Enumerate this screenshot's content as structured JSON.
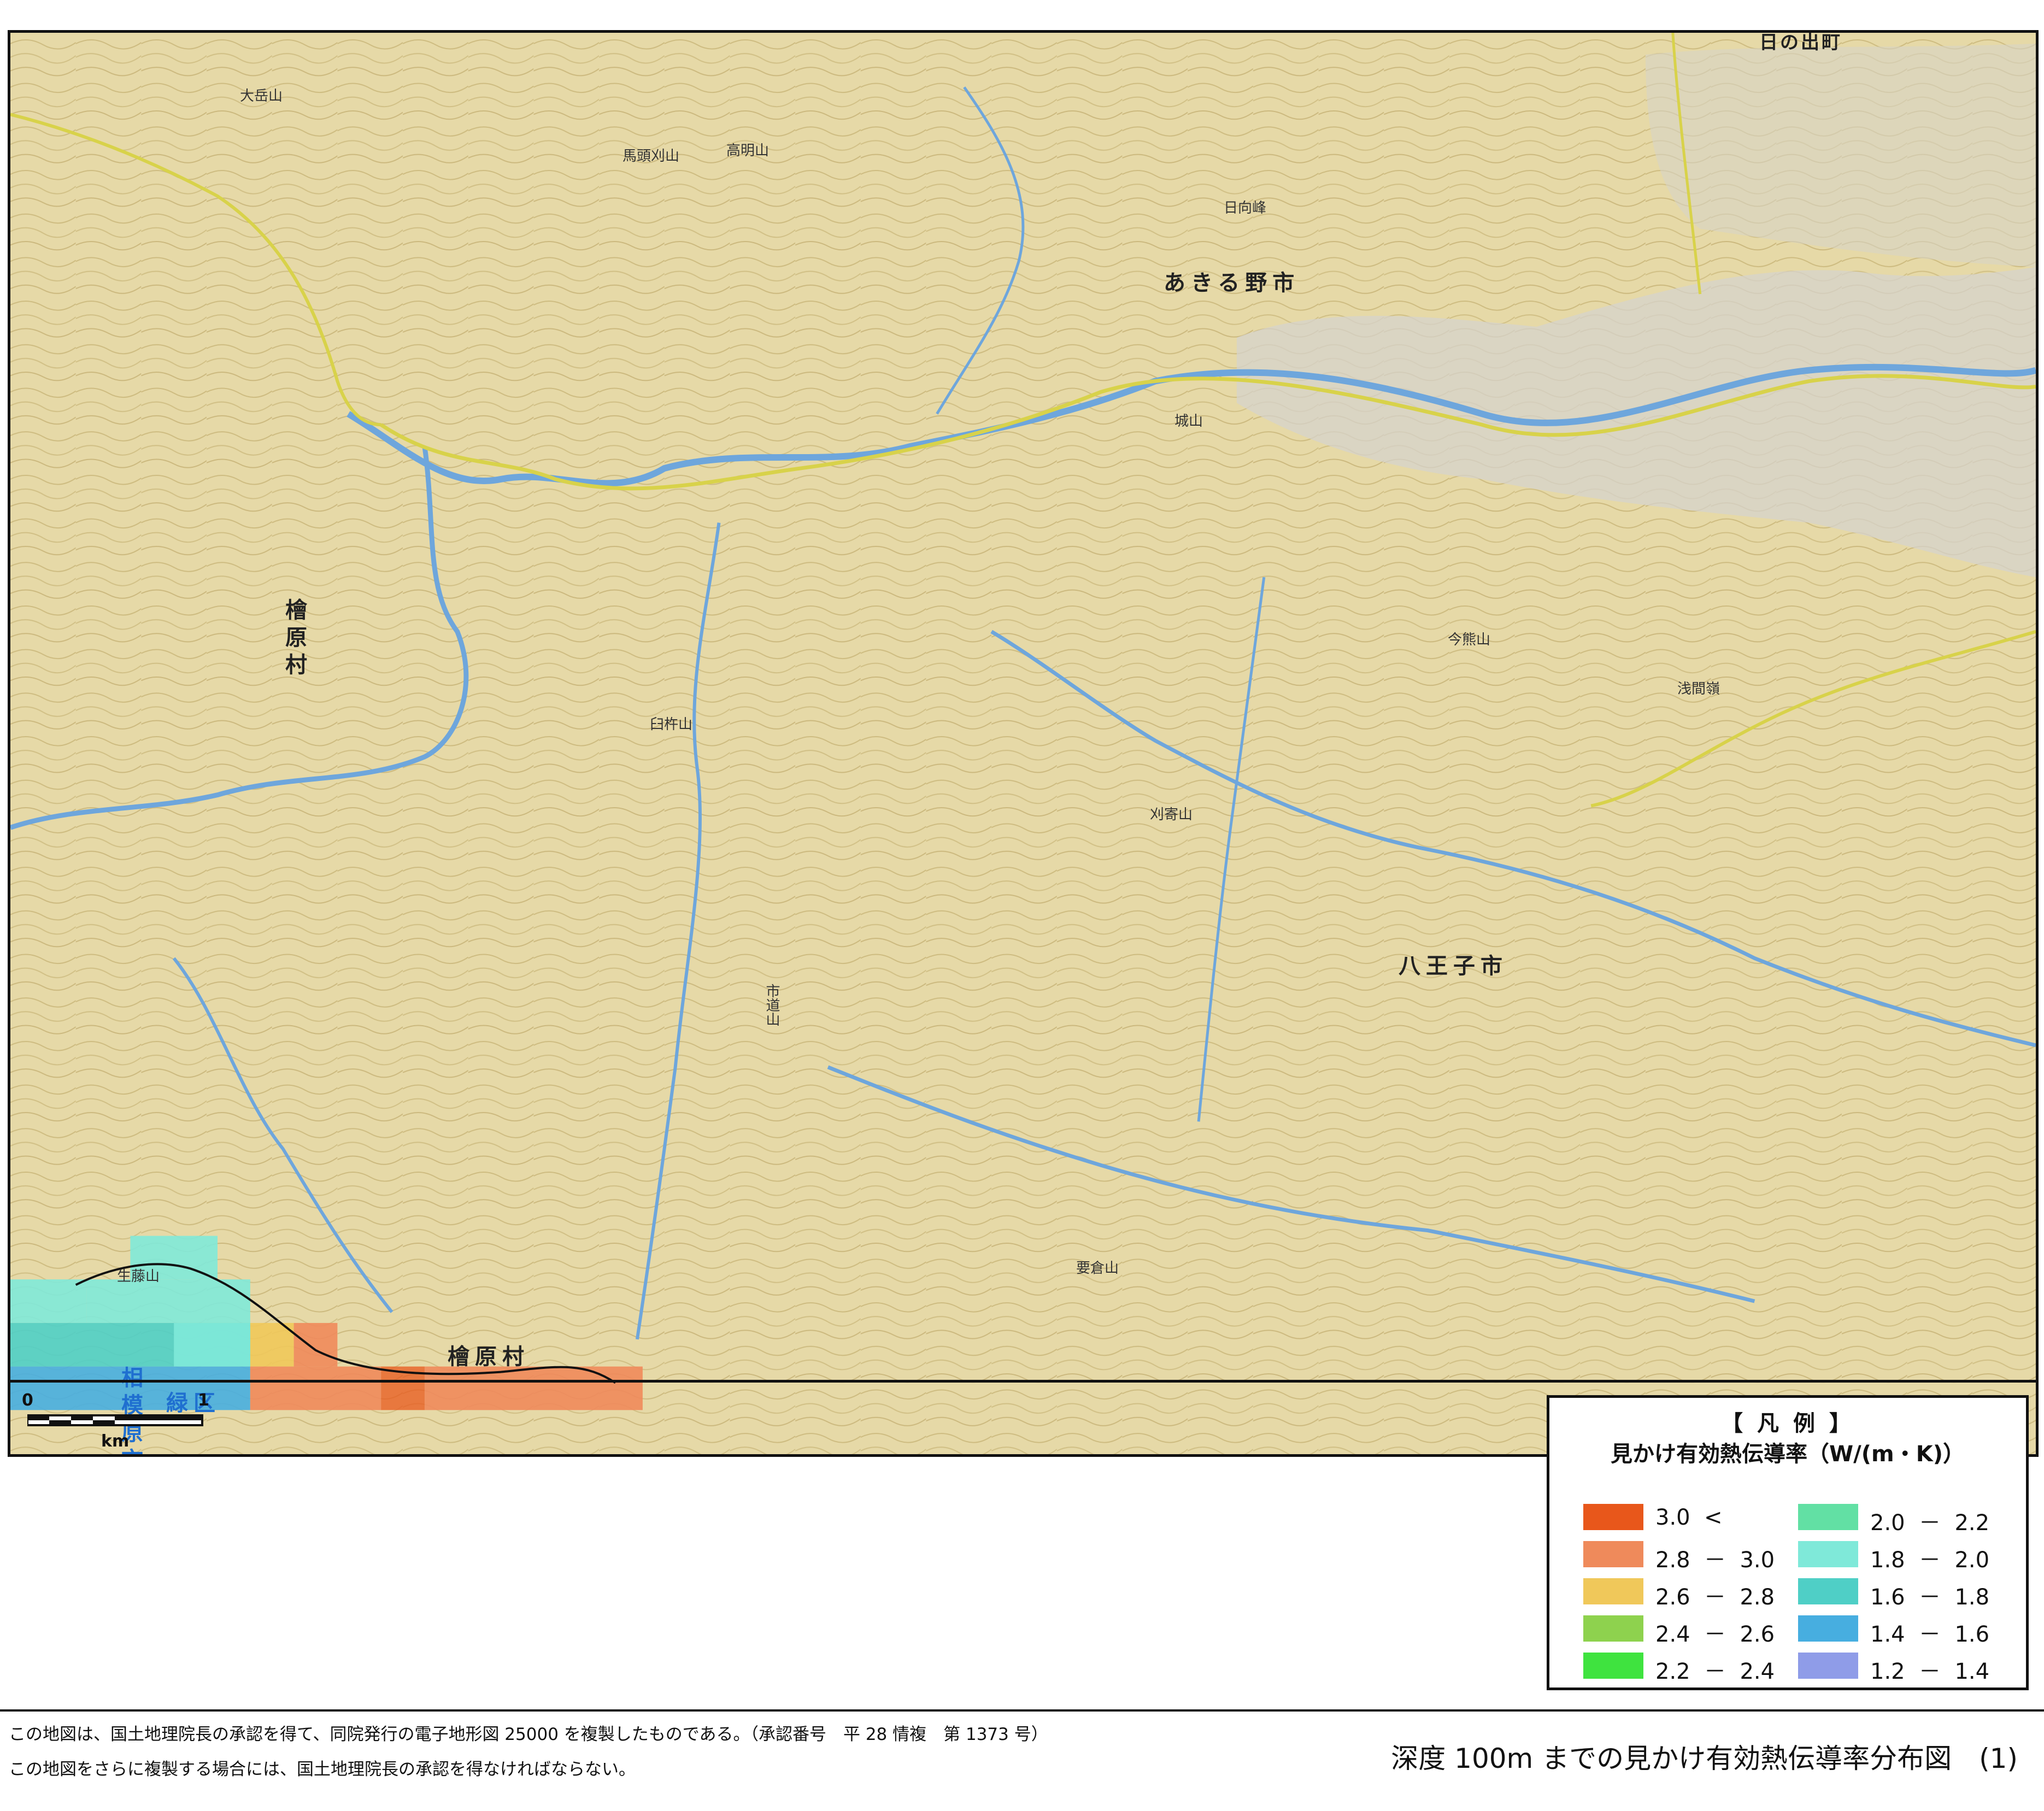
{
  "map": {
    "labels": {
      "hinode": "日の出町",
      "akiruno": "あきる野市",
      "hinohara_north": "檜原村",
      "hinohara_south": "檜原村",
      "hachioji": "八王子市",
      "sagamihara_ward": "緑区",
      "sagamihara_city": "相模原市"
    },
    "peaks": [
      "馬頭刈山",
      "高明山",
      "大岳山",
      "日向峰",
      "臼杵山",
      "刈寄山",
      "市道山",
      "要倉山",
      "城山",
      "生藤山",
      "浅間嶺",
      "今熊山"
    ],
    "scale": {
      "start": "0",
      "end": "1",
      "unit": "km"
    }
  },
  "legend": {
    "title": "【 凡 例 】",
    "subtitle": "見かけ有効熱伝導率（W/(m・K)）",
    "items": [
      {
        "label": "3.0  <",
        "color": "#e8571b"
      },
      {
        "label": "2.8  －  3.0",
        "color": "#ef8a5b"
      },
      {
        "label": "2.6  －  2.8",
        "color": "#f0c85a"
      },
      {
        "label": "2.4  －  2.6",
        "color": "#8ed24e"
      },
      {
        "label": "2.2  －  2.4",
        "color": "#3fe33f"
      },
      {
        "label": "2.0  －  2.2",
        "color": "#62e0a4"
      },
      {
        "label": "1.8  －  2.0",
        "color": "#7fe9d9"
      },
      {
        "label": "1.6  －  1.8",
        "color": "#4fcfc6"
      },
      {
        "label": "1.4  －  1.6",
        "color": "#47aee0"
      },
      {
        "label": "1.2  －  1.4",
        "color": "#8f9ce8"
      }
    ]
  },
  "footer": {
    "credit1": "この地図は、国土地理院長の承認を得て、同院発行の電子地形図 25000 を複製したものである。（承認番号　平 28 情複　第 1373 号）",
    "credit2": "この地図をさらに複製する場合には、国土地理院長の承認を得なければならない。",
    "figure_title": "深度 100m までの見かけ有効熱伝導率分布図　(1)"
  },
  "colors": {
    "terrain": "#e6d9a7",
    "river": "#6ea6dc",
    "road": "#d8d24a",
    "urban": "#c9ccd6"
  }
}
